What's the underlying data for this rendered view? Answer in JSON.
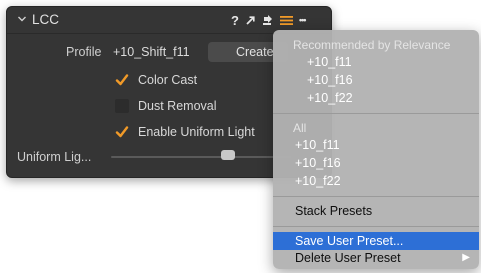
{
  "panel": {
    "title": "LCC",
    "header_icons": {
      "help": "?",
      "apply": "arrow-icon",
      "copy": "copy-icon",
      "presets": "presets-menu-icon",
      "more": "•••"
    },
    "profile": {
      "label": "Profile",
      "value": "+10_Shift_f11",
      "create_button": "Create"
    },
    "checkboxes": [
      {
        "label": "Color Cast",
        "checked": true
      },
      {
        "label": "Dust Removal",
        "checked": false
      },
      {
        "label": "Enable Uniform Light",
        "checked": true
      }
    ],
    "uniform_light": {
      "label": "Uniform Lig...",
      "level_percent": 65
    },
    "accent_color": "#f19a28"
  },
  "menu": {
    "recommended_header": "Recommended by Relevance",
    "recommended": [
      "+10_f11",
      "+10_f16",
      "+10_f22"
    ],
    "all_header": "All",
    "all": [
      "+10_f11",
      "+10_f16",
      "+10_f22"
    ],
    "stack_presets": "Stack Presets",
    "save_user_preset": "Save User Preset...",
    "delete_user_preset": "Delete User Preset",
    "highlight_color": "#2d6fd6"
  }
}
